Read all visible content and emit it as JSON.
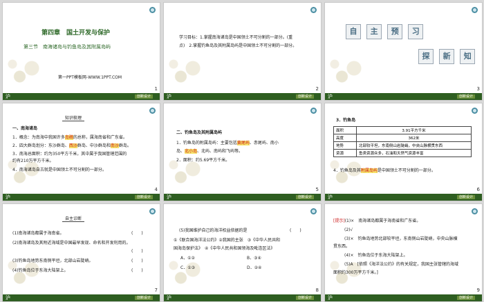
{
  "footer": {
    "label": "沪",
    "tag": "创新设计"
  },
  "slides": [
    {
      "num": "1",
      "chapter": "第四章　国土开发与保护",
      "section": "第三节　南海诸岛与钓鱼岛及其附属岛屿",
      "site": "第一PPT模板网-WWW.1PPT.COM"
    },
    {
      "num": "2",
      "lines": [
        "学习目标：1.掌握南海诸岛是中国领土不可分割的一部分。(重",
        "点)　2.掌握钓鱼岛及其附属岛屿是中国领土不可分割的一部分。"
      ]
    },
    {
      "num": "3",
      "row1": [
        "自",
        "主",
        "预",
        "习"
      ],
      "row2": [
        "探",
        "新",
        "知"
      ]
    },
    {
      "num": "4",
      "tab": "知识梳理",
      "heading": "一、南海诸岛",
      "l1a": "1．概念：为南海中我国许多",
      "l1b": "岛礁",
      "l1c": "的总称，属海南省和广东省。",
      "l2a": "2．四大群岛划分：东沙群岛、",
      "l2b": "西沙",
      "l2c": "群岛、中沙群岛和",
      "l2d": "南沙",
      "l2e": "群岛。",
      "l3a": "3．南海总面积：约为350平方千米，其中属于我国管辖范围的",
      "l3b": "约有210万平方千米。",
      "l4": "4．南海诸岛自古就是中国领土不可分割的一部分。"
    },
    {
      "num": "5",
      "heading": "二、钓鱼岛及其附属岛屿",
      "l1a": "1．钓鱼岛的附属岛屿：主要包括",
      "l1b": "黄尾屿",
      "l1c": "、赤尾屿、南小",
      "l1d": "岛、",
      "l1e": "北小岛",
      "l1f": "、北屿、南屿和飞屿等。",
      "l2": "2．面积：约5.69平方千米。"
    },
    {
      "num": "6",
      "heading": "3．钓鱼岛",
      "table": [
        [
          "面积",
          "3.91平方千米"
        ],
        [
          "高度",
          "362米"
        ],
        [
          "地势",
          "北部较平坦，东南侧山岩陡峭，中央山脉横贯东西"
        ],
        [
          "资源",
          "鱼类资源众多，石油和天然气资源丰富"
        ]
      ],
      "t2b": "平坦",
      "foot_a": "4．钓鱼岛及其",
      "foot_b": "附属岛屿",
      "foot_c": "是中国领土不可分割的一部分。"
    },
    {
      "num": "7",
      "tab": "自主诊断",
      "items": [
        "(1)南海诸岛都属于海南省。",
        "(2)南海诸岛及其附近海域是中国最早发现、命名和开发利用的。",
        "(3)钓鱼岛地势东南侧平坦，北部山岩陡峭。",
        "(4)钓鱼岛位于东海大陆架上。"
      ],
      "paren": "(　　)"
    },
    {
      "num": "8",
      "q": "(5)我国维护自己的海洋权益依据的是",
      "paren": "(　　)",
      "o1": "①《联合国海洋法公约》②我国的主张　③《中华人民共和",
      "o2": "国海岛保护法》　④《中华人民共和国领海及毗连区法》",
      "a": "A．①②",
      "b": "B．③④",
      "c": "C．①③",
      "d": "D．②④"
    },
    {
      "num": "9",
      "tip": "[提示]",
      "l1": "(1)×　南海诸岛都属于海南省和广东省。",
      "l2": "(2)√",
      "l3a": "(3)×　钓鱼岛地势北部较平坦，东南侧山岩陡峭，中央山脉横",
      "l3b": "贯东西。",
      "l4": "(4)×　钓鱼岛位于东海大陆架上。",
      "l5a": "(5)A　[依照《海洋法公约》的有关规定，我国主张管辖的海域",
      "l5b": "面积约300万平方千米。]"
    }
  ]
}
